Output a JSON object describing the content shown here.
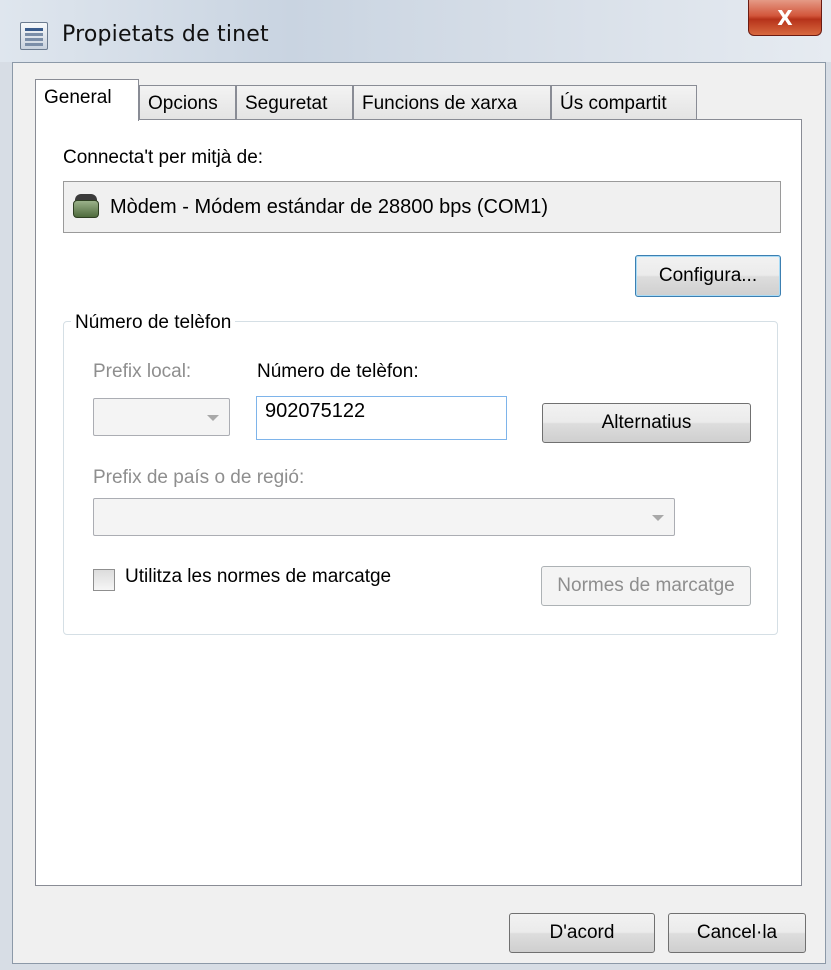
{
  "window": {
    "title": "Propietats de tinet",
    "close_label": "X"
  },
  "tabs": [
    {
      "label": "General",
      "active": true
    },
    {
      "label": "Opcions",
      "active": false
    },
    {
      "label": "Seguretat",
      "active": false
    },
    {
      "label": "Funcions de xarxa",
      "active": false
    },
    {
      "label": "Ús compartit",
      "active": false
    }
  ],
  "general": {
    "connect_label": "Connecta't per mitjà de:",
    "device": "Mòdem - Módem estándar de 28800 bps (COM1)",
    "configure_button": "Configura...",
    "phone_group": {
      "legend": "Número de telèfon",
      "prefix_label": "Prefix local:",
      "prefix_value": "",
      "number_label": "Número de telèfon:",
      "number_value": "902075122",
      "alternates_button": "Alternatius",
      "country_label": "Prefix de país o de regió:",
      "country_value": "",
      "dialing_rules_checkbox_label": "Utilitza les normes de marcatge",
      "dialing_rules_checked": false,
      "dialing_rules_button": "Normes de marcatge"
    }
  },
  "footer": {
    "ok_button": "D'acord",
    "cancel_button": "Cancel·la"
  }
}
